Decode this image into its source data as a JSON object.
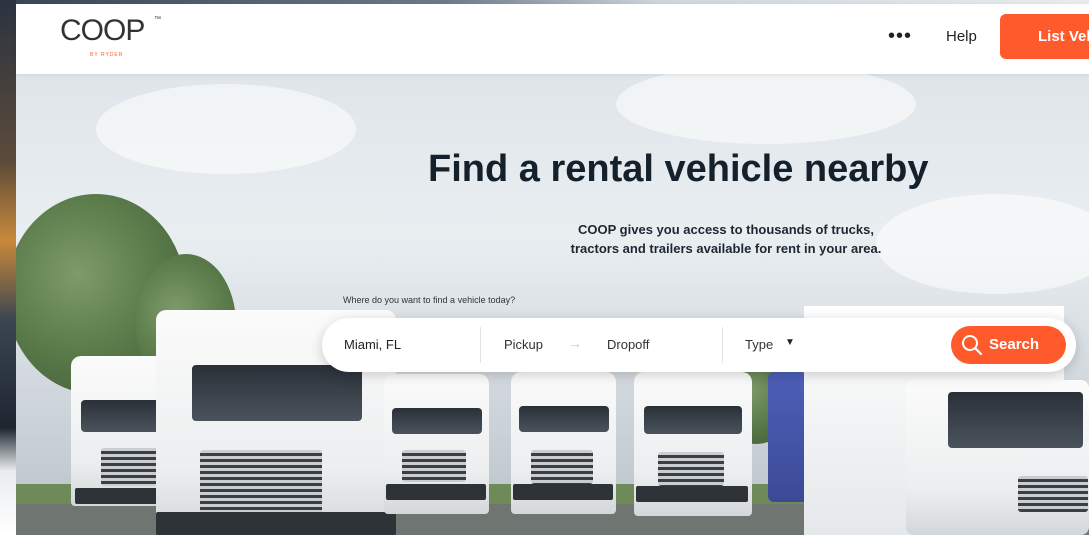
{
  "brand": {
    "logo_text": "COOP",
    "logo_tm": "™",
    "logo_sub": "BY RYDER",
    "accent_color": "#ff5a2c"
  },
  "header": {
    "more_icon": "ellipsis-horizontal",
    "more_label": "•••",
    "help_label": "Help",
    "list_vehicle_label": "List Vehicle"
  },
  "hero": {
    "title": "Find a rental vehicle nearby",
    "subtitle_line1": "COOP gives you access to thousands of trucks,",
    "subtitle_line2": "tractors and trailers available for rent in your area.",
    "search_prompt": "Where do you want to find a vehicle today?"
  },
  "search": {
    "location_value": "Miami, FL",
    "pickup_placeholder": "Pickup",
    "arrow": "→",
    "dropoff_placeholder": "Dropoff",
    "type_label": "Type",
    "type_caret": "▼",
    "search_icon": "magnifier-icon",
    "search_label": "Search"
  }
}
